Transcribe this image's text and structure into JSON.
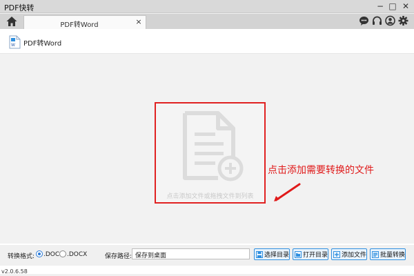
{
  "window": {
    "title": "PDF快转",
    "minimize_glyph": "−",
    "maximize_glyph": "□",
    "close_glyph": "✕"
  },
  "tabs": [
    {
      "label": "PDF转Word",
      "close_glyph": "×"
    }
  ],
  "toolbar_icons": [
    "chat-icon",
    "headset-icon",
    "user-icon",
    "gear-icon"
  ],
  "subheader": {
    "title": "PDF转Word"
  },
  "dropzone": {
    "hint": "点击添加文件或拖拽文件到列表",
    "annotation": "点击添加需要转换的文件"
  },
  "footer": {
    "format_label": "转换格式:",
    "options": [
      {
        "label": ".DOC",
        "selected": true
      },
      {
        "label": ".DOCX",
        "selected": false
      }
    ],
    "path_label": "保存路径:",
    "path_value": "保存到桌面",
    "buttons": {
      "choose_dir": "选择目录",
      "open_dir": "打开目录",
      "add_file": "添加文件",
      "batch_convert": "批量转换"
    }
  },
  "version": "v2.0.6.58",
  "colors": {
    "accent": "#2f8fdf",
    "highlight": "#e02020",
    "titlebar": "#d9d9d9"
  }
}
